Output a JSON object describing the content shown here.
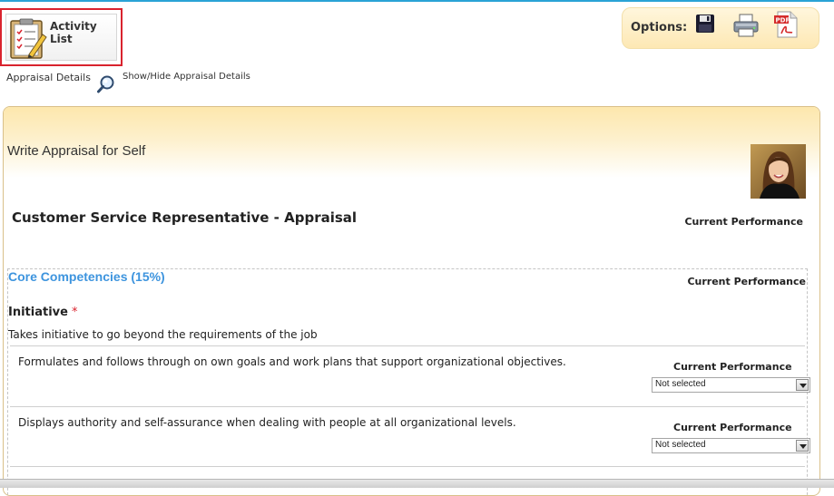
{
  "activity_list": {
    "label": "Activity List",
    "icon": "clipboard-checklist-icon"
  },
  "options": {
    "label": "Options:",
    "icons": [
      "save-icon",
      "print-icon",
      "pdf-icon"
    ]
  },
  "appraisal_details": {
    "label": "Appraisal Details",
    "toggle_label": "Show/Hide Appraisal Details",
    "icon": "magnifier-icon"
  },
  "main": {
    "title": "Write Appraisal for Self",
    "appraisal_title": "Customer Service Representative - Appraisal",
    "current_performance_label": "Current Performance",
    "section": {
      "title": "Core Competencies (15%)",
      "current_performance_label": "Current Performance",
      "competency": {
        "name": "Initiative",
        "required_marker": "*",
        "description": "Takes initiative to go beyond the requirements of the job",
        "items": [
          {
            "text": "Formulates and follows through on own goals and work plans that support organizational objectives.",
            "performance_label": "Current Performance",
            "selected": "Not selected"
          },
          {
            "text": "Displays authority and self-assurance when dealing with people at all organizational levels.",
            "performance_label": "Current Performance",
            "selected": "Not selected"
          }
        ]
      }
    }
  },
  "colors": {
    "accent_blue": "#3d94de",
    "highlight_red": "#d9232e",
    "header_gold": "#fde7ad"
  }
}
